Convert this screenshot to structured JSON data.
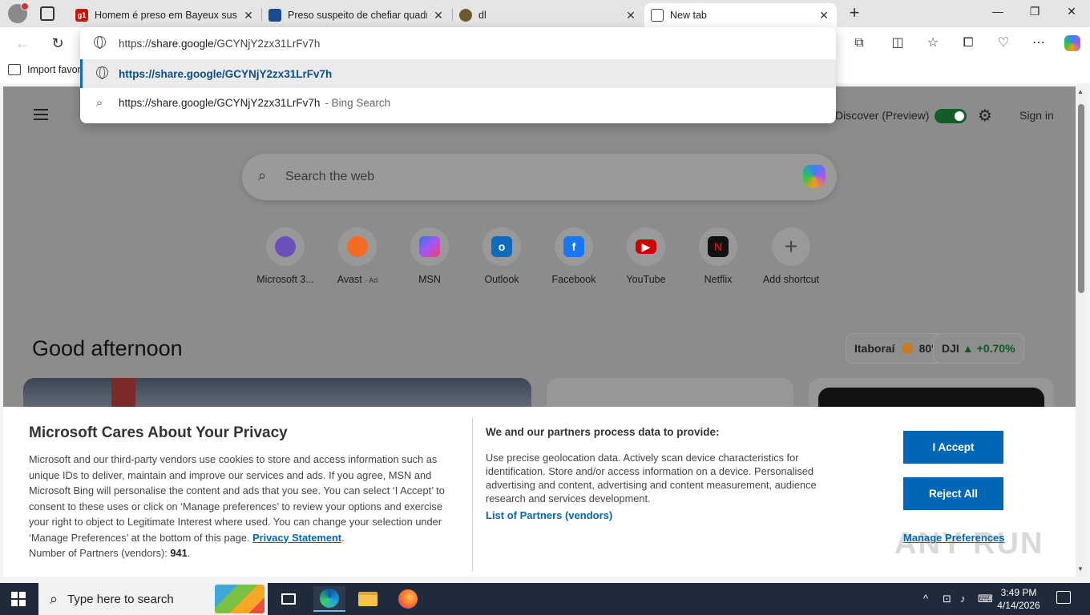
{
  "tabs": [
    {
      "title": "Homem é preso em Bayeux suspe",
      "favicon": "g1",
      "color": "#c4170c"
    },
    {
      "title": "Preso suspeito de chefiar quadrilh",
      "favicon": "news-icon",
      "color": "#1a4d8f"
    },
    {
      "title": "dl",
      "favicon": "seal-icon",
      "color": "#6b5a2c"
    },
    {
      "title": "New tab",
      "favicon": "newtab-icon",
      "color": "#444444"
    }
  ],
  "bookmarks": {
    "import_label": "Import favor"
  },
  "omnibox": {
    "input_prefix": "https://",
    "input_domain": "share.google",
    "input_path": "/GCYNjY2zx31LrFv7h",
    "suggestion_url": "https://share.google/GCYNjY2zx31LrFv7h",
    "search_text": "https://share.google/GCYNjY2zx31LrFv7h",
    "search_suffix": "- Bing Search"
  },
  "ntp": {
    "discover_label": "Discover (Preview)",
    "signin_label": "Sign in",
    "search_placeholder": "Search the web",
    "greeting": "Good afternoon",
    "shortcuts": [
      {
        "label": "Microsoft 3...",
        "icon": "m365-icon",
        "color": "#6b4fbb"
      },
      {
        "label": "Avast",
        "ad": "· Ad",
        "icon": "avast-icon",
        "color": "#f36c21"
      },
      {
        "label": "MSN",
        "icon": "msn-icon",
        "color": "#2c7be5"
      },
      {
        "label": "Outlook",
        "icon": "outlook-icon",
        "color": "#0f6cbd"
      },
      {
        "label": "Facebook",
        "icon": "facebook-icon",
        "color": "#1877f2"
      },
      {
        "label": "YouTube",
        "icon": "youtube-icon",
        "color": "#ff0000"
      },
      {
        "label": "Netflix",
        "icon": "netflix-icon",
        "color": "#111111"
      },
      {
        "label": "Add shortcut",
        "icon": "plus-icon",
        "color": "#555555"
      }
    ],
    "weather": {
      "city": "Itaboraí",
      "temp": "80°"
    },
    "stock": {
      "symbol": "DJI",
      "change": "+0.70%"
    }
  },
  "privacy": {
    "title": "Microsoft Cares About Your Privacy",
    "body": "Microsoft and our third-party vendors use cookies to store and access information such as unique IDs to deliver, maintain and improve our services and ads. If you agree, MSN and Microsoft Bing will personalise the content and ads that you see. You can select ‘I Accept’ to consent to these uses or click on ‘Manage preferences’ to review your options and exercise your right to object to Legitimate Interest where used.  You can change your selection under ‘Manage Preferences’ at the bottom of this page.",
    "privacy_link": "Privacy Statement",
    "partners_prefix": "Number of Partners (vendors):",
    "partners_count": "941",
    "heading2": "We and our partners process data to provide:",
    "body2": "Use precise geolocation data. Actively scan device characteristics for identification. Store and/or access information on a device. Personalised advertising and content, advertising and content measurement, audience research and services development.",
    "list_link": "List of Partners (vendors)",
    "accept_label": "I Accept",
    "reject_label": "Reject All",
    "manage_label": "Manage Preferences",
    "accent": "#0067b8"
  },
  "watermark": "ANY RUN",
  "taskbar": {
    "search_placeholder": "Type here to search",
    "time": "3:49 PM",
    "date": "4/14/2026"
  }
}
